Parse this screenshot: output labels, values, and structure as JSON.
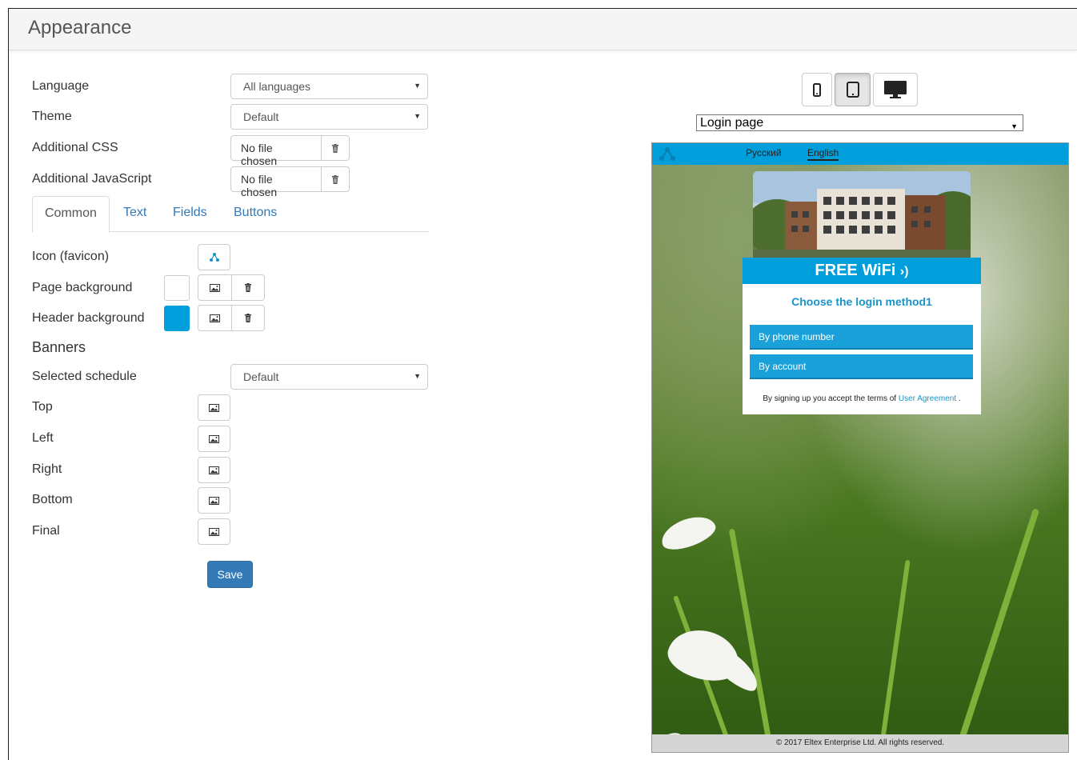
{
  "panel": {
    "title": "Appearance"
  },
  "form": {
    "language": {
      "label": "Language",
      "value": "All languages"
    },
    "theme": {
      "label": "Theme",
      "value": "Default"
    },
    "additional_css": {
      "label": "Additional CSS",
      "file": "No file chosen"
    },
    "additional_js": {
      "label": "Additional JavaScript",
      "file": "No file chosen"
    }
  },
  "tabs": [
    {
      "label": "Common",
      "active": true
    },
    {
      "label": "Text",
      "active": false
    },
    {
      "label": "Fields",
      "active": false
    },
    {
      "label": "Buttons",
      "active": false
    }
  ],
  "common": {
    "icon_label": "Icon (favicon)",
    "page_bg_label": "Page background",
    "page_bg_color": "#ffffff",
    "header_bg_label": "Header background",
    "header_bg_color": "#009fdb",
    "banners_heading": "Banners",
    "schedule_label": "Selected schedule",
    "schedule_value": "Default",
    "banner_top": "Top",
    "banner_left": "Left",
    "banner_right": "Right",
    "banner_bottom": "Bottom",
    "banner_final": "Final",
    "save_label": "Save"
  },
  "preview": {
    "device_buttons": [
      "phone-icon",
      "tablet-icon",
      "desktop-icon"
    ],
    "active_device": "tablet",
    "page_select": "Login page",
    "lang_ru": "Русский",
    "lang_en": "English",
    "brand": "FREE WiFi",
    "choose": "Choose the login method1",
    "btn_phone": "By phone number",
    "btn_account": "By account",
    "terms_prefix": "By signing up you accept the terms of",
    "terms_link": "User Agreement",
    "terms_suffix": ".",
    "footer": "© 2017 Eltex Enterprise Ltd. All rights reserved.",
    "accent_color": "#009fdb"
  }
}
